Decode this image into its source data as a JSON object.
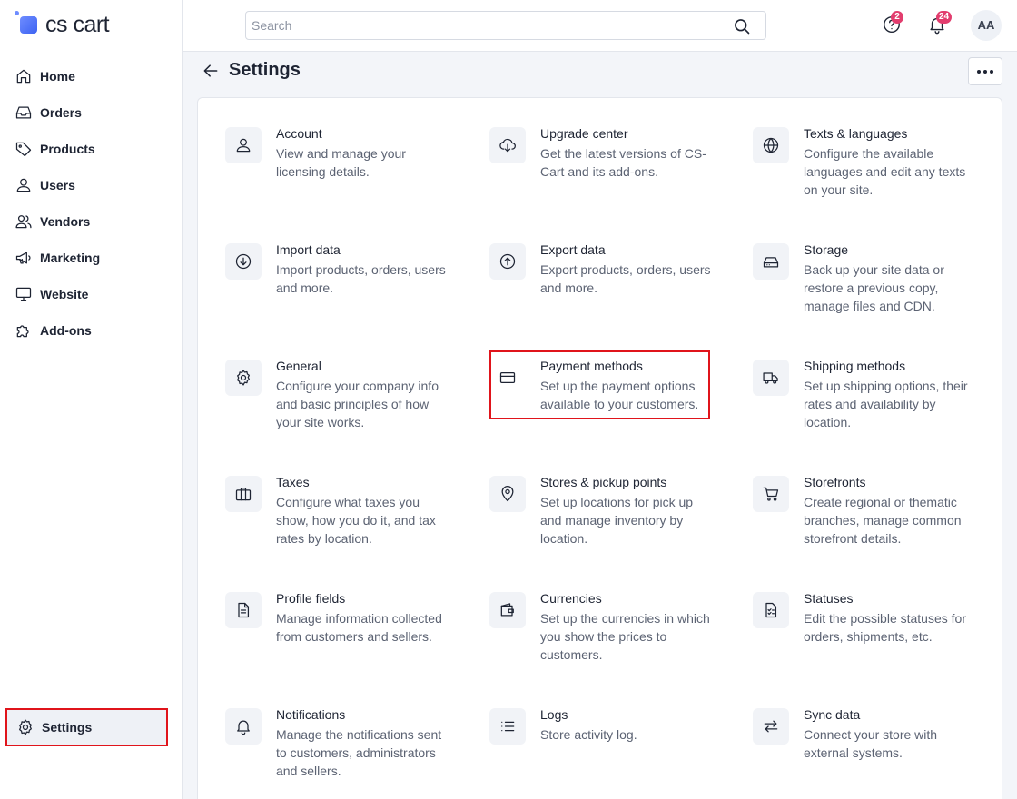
{
  "brand": {
    "name": "cs cart"
  },
  "sidebar": {
    "items": [
      {
        "label": "Home",
        "icon": "home-icon"
      },
      {
        "label": "Orders",
        "icon": "inbox-icon"
      },
      {
        "label": "Products",
        "icon": "tag-icon"
      },
      {
        "label": "Users",
        "icon": "user-icon"
      },
      {
        "label": "Vendors",
        "icon": "users-icon"
      },
      {
        "label": "Marketing",
        "icon": "megaphone-icon"
      },
      {
        "label": "Website",
        "icon": "monitor-icon"
      },
      {
        "label": "Add-ons",
        "icon": "puzzle-icon"
      }
    ],
    "settings_label": "Settings"
  },
  "topbar": {
    "search_placeholder": "Search",
    "help_badge": "2",
    "notifications_badge": "24",
    "avatar_initials": "AA"
  },
  "page": {
    "title": "Settings"
  },
  "cards": [
    {
      "title": "Account",
      "desc": "View and manage your licensing details.",
      "icon": "user-icon"
    },
    {
      "title": "Upgrade center",
      "desc": "Get the latest versions of CS-Cart and its add-ons.",
      "icon": "cloud-download-icon"
    },
    {
      "title": "Texts & languages",
      "desc": "Configure the available languages and edit any texts on your site.",
      "icon": "globe-icon"
    },
    {
      "title": "Import data",
      "desc": "Import products, orders, users and more.",
      "icon": "arrow-down-circle-icon"
    },
    {
      "title": "Export data",
      "desc": "Export products, orders, users and more.",
      "icon": "arrow-up-circle-icon"
    },
    {
      "title": "Storage",
      "desc": "Back up your site data or restore a previous copy, manage files and CDN.",
      "icon": "hard-drive-icon"
    },
    {
      "title": "General",
      "desc": "Configure your company info and basic principles of how your site works.",
      "icon": "gear-icon"
    },
    {
      "title": "Payment methods",
      "desc": "Set up the payment options available to your customers.",
      "icon": "credit-card-icon"
    },
    {
      "title": "Shipping methods",
      "desc": "Set up shipping options, their rates and availability by location.",
      "icon": "truck-icon"
    },
    {
      "title": "Taxes",
      "desc": "Configure what taxes you show, how you do it, and tax rates by location.",
      "icon": "briefcase-icon"
    },
    {
      "title": "Stores & pickup points",
      "desc": "Set up locations for pick up and manage inventory by location.",
      "icon": "map-pin-icon"
    },
    {
      "title": "Storefronts",
      "desc": "Create regional or thematic branches, manage common storefront details.",
      "icon": "cart-icon"
    },
    {
      "title": "Profile fields",
      "desc": "Manage information collected from customers and sellers.",
      "icon": "document-icon"
    },
    {
      "title": "Currencies",
      "desc": "Set up the currencies in which you show the prices to customers.",
      "icon": "wallet-icon"
    },
    {
      "title": "Statuses",
      "desc": "Edit the possible statuses for orders, shipments, etc.",
      "icon": "checklist-icon"
    },
    {
      "title": "Notifications",
      "desc": "Manage the notifications sent to customers, administrators and sellers.",
      "icon": "bell-icon"
    },
    {
      "title": "Logs",
      "desc": "Store activity log.",
      "icon": "list-icon"
    },
    {
      "title": "Sync data",
      "desc": "Connect your store with external systems.",
      "icon": "arrows-swap-icon"
    }
  ]
}
